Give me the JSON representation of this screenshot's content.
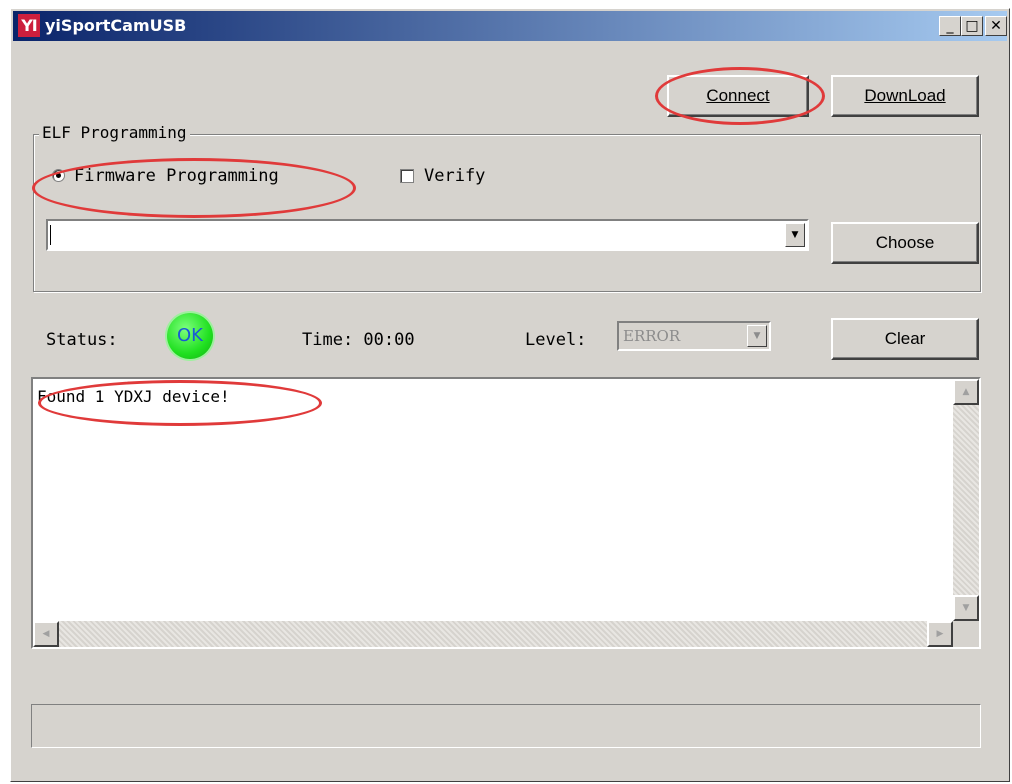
{
  "window": {
    "title": "yiSportCamUSB",
    "icon_text": "YI"
  },
  "titlebar_buttons": {
    "minimize": "_",
    "maximize": "□",
    "close": "✕"
  },
  "toolbar": {
    "connect": "Connect",
    "download": "DownLoad"
  },
  "elf": {
    "group_label": "ELF Programming",
    "firmware_label": "Firmware Programming",
    "firmware_selected": true,
    "verify_label": "Verify",
    "verify_checked": false,
    "file_path": "",
    "choose": "Choose"
  },
  "status": {
    "label": "Status:",
    "indicator": "OK",
    "time_label": "Time: 00:00",
    "level_label": "Level:",
    "level_value": "ERROR",
    "clear": "Clear"
  },
  "log": {
    "lines": [
      "Found 1 YDXJ device!"
    ]
  },
  "colors": {
    "highlight": "#e03a3a",
    "ok": "#20e020",
    "title_start": "#0a246a",
    "title_end": "#a6caf0"
  }
}
